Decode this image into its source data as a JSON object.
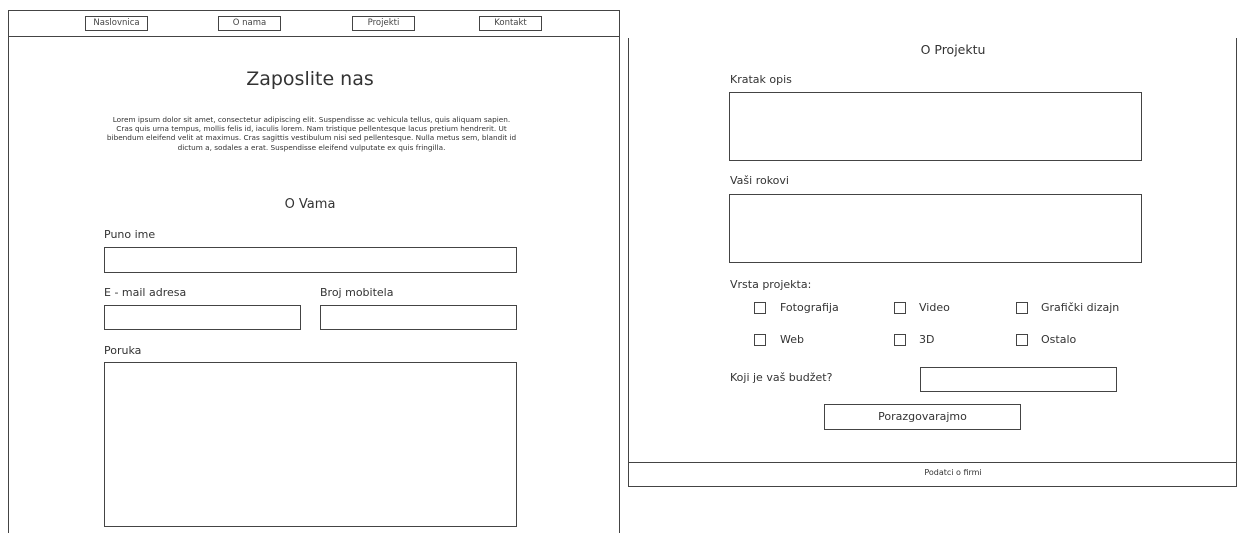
{
  "nav": {
    "items": [
      "Naslovnica",
      "O nama",
      "Projekti",
      "Kontakt"
    ]
  },
  "left": {
    "page_title": "Zaposlite nas",
    "intro_text": "Lorem ipsum dolor sit amet, consectetur adipiscing elit. Suspendisse ac vehicula tellus, quis aliquam sapien. Cras quis urna tempus, mollis felis id, iaculis lorem. Nam tristique pellentesque lacus pretium hendrerit. Ut bibendum eleifend velit at maximus. Cras sagittis vestibulum nisi sed pellentesque. Nulla metus sem, blandit id dictum a, sodales a erat. Suspendisse eleifend vulputate ex quis fringilla.",
    "section_title": "O Vama",
    "full_name_label": "Puno ime",
    "email_label": "E - mail adresa",
    "phone_label": "Broj mobitela",
    "message_label": "Poruka"
  },
  "right": {
    "section_title": "O Projektu",
    "short_desc_label": "Kratak opis",
    "deadlines_label": "Vaši rokovi",
    "project_type_label": "Vrsta projekta:",
    "project_types": [
      "Fotografija",
      "Video",
      "Grafički dizajn",
      "Web",
      "3D",
      "Ostalo"
    ],
    "budget_label": "Koji je vaš budžet?",
    "submit_label": "Porazgovarajmo",
    "footer_text": "Podatci o firmi"
  }
}
